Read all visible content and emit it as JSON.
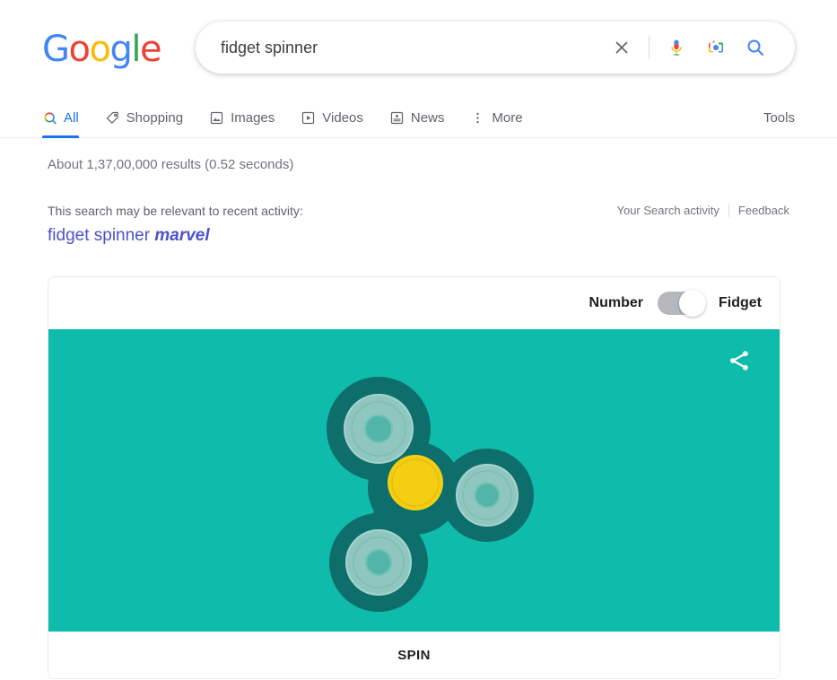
{
  "brand": {
    "name": "Google",
    "letters": [
      {
        "ch": "G",
        "color": "#4285F4"
      },
      {
        "ch": "o",
        "color": "#EA4335"
      },
      {
        "ch": "o",
        "color": "#FBBC05"
      },
      {
        "ch": "g",
        "color": "#4285F4"
      },
      {
        "ch": "l",
        "color": "#34A853"
      },
      {
        "ch": "e",
        "color": "#EA4335"
      }
    ]
  },
  "search": {
    "value": "fidget spinner",
    "placeholder": "Search",
    "clear_icon": "close-icon",
    "voice_icon": "microphone-icon",
    "lens_icon": "google-lens-camera-icon",
    "submit_icon": "search-icon"
  },
  "nav": {
    "tabs": [
      {
        "label": "All",
        "icon": "search-icon",
        "active": true
      },
      {
        "label": "Shopping",
        "icon": "price-tag-icon",
        "active": false
      },
      {
        "label": "Images",
        "icon": "image-icon",
        "active": false
      },
      {
        "label": "Videos",
        "icon": "play-box-icon",
        "active": false
      },
      {
        "label": "News",
        "icon": "newspaper-icon",
        "active": false
      },
      {
        "label": "More",
        "icon": "more-vertical-icon",
        "active": false
      }
    ],
    "tools_label": "Tools",
    "active_color": "#1a73e8"
  },
  "results": {
    "stats": "About 1,37,00,000 results (0.52 seconds)",
    "activity_note": "This search may be relevant to recent activity:",
    "activity_query_plain": "fidget spinner ",
    "activity_query_bold": "marvel",
    "search_activity_link": "Your Search activity",
    "feedback_link": "Feedback"
  },
  "spinner_card": {
    "mode_left_label": "Number",
    "mode_right_label": "Fidget",
    "toggle_state": "right",
    "share_icon": "share-icon",
    "spin_button_label": "SPIN",
    "background_color": "#0FBBAB",
    "body_color": "#0E6E6B",
    "ring_outer_color": "#8FC7C0",
    "ring_inner_color": "#6FBCB2",
    "hub_color": "#F4CE12"
  }
}
